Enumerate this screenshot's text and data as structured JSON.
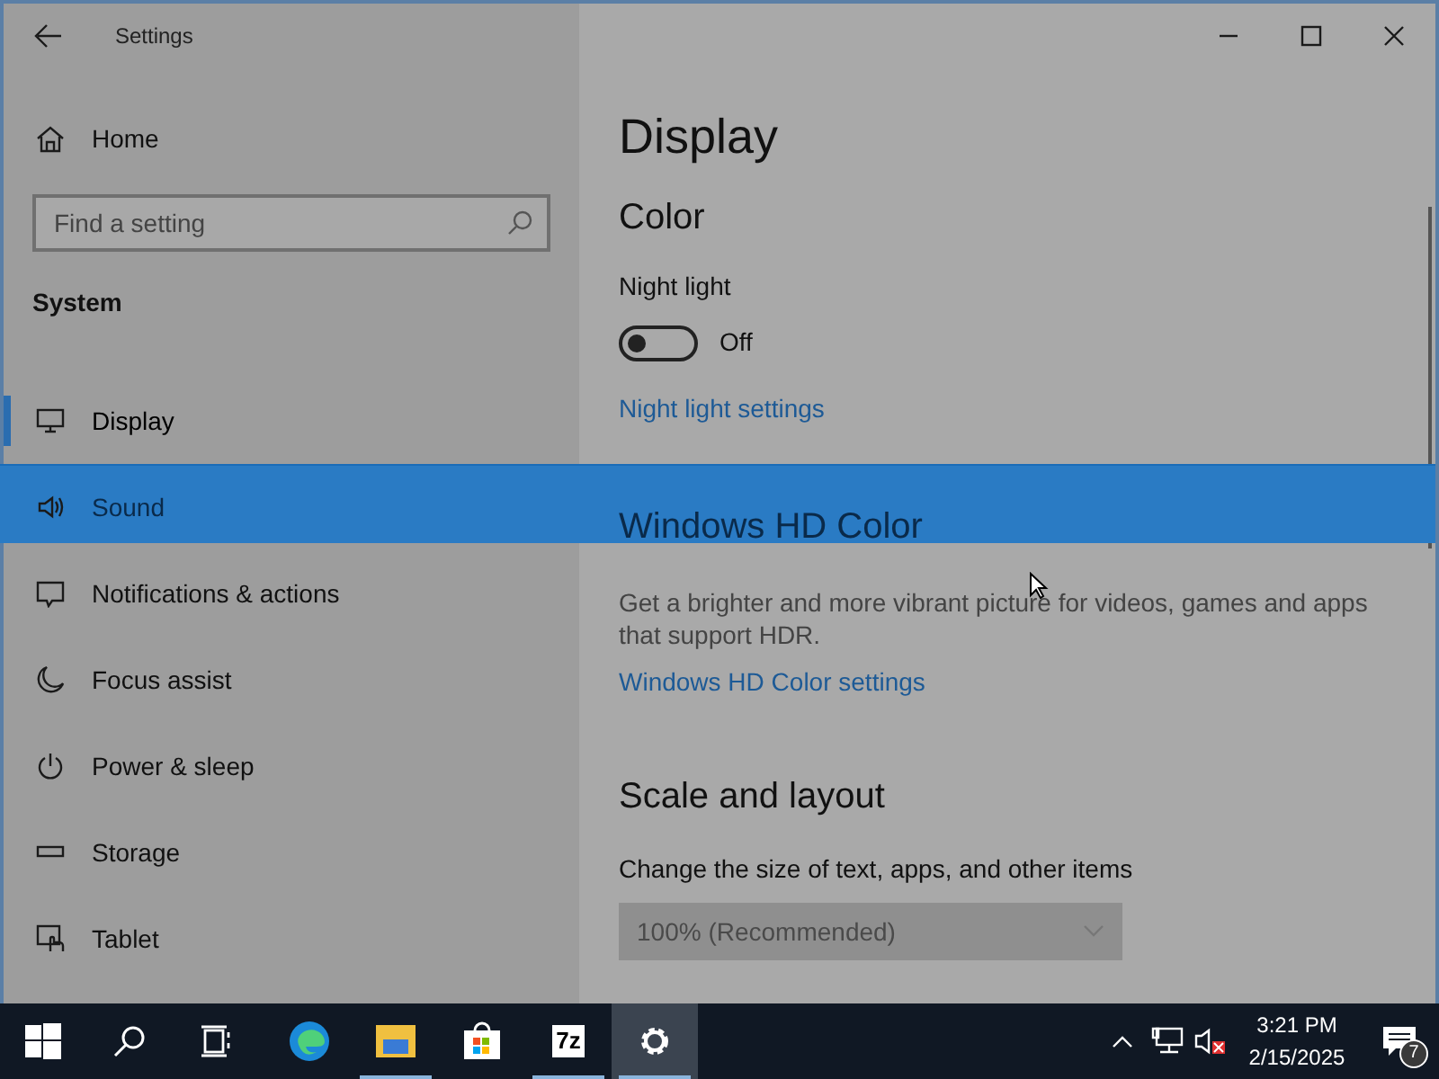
{
  "window": {
    "title": "Settings"
  },
  "sidebar": {
    "home": "Home",
    "search": {
      "placeholder": "Find a setting"
    },
    "section": "System",
    "items": [
      {
        "label": "Display",
        "selected": true
      },
      {
        "label": "Sound",
        "selected": false
      },
      {
        "label": "Notifications & actions",
        "selected": false
      },
      {
        "label": "Focus assist",
        "selected": false
      },
      {
        "label": "Power & sleep",
        "selected": false
      },
      {
        "label": "Storage",
        "selected": false
      },
      {
        "label": "Tablet",
        "selected": false
      }
    ]
  },
  "content": {
    "title": "Display",
    "color": {
      "heading": "Color",
      "night_light": {
        "label": "Night light",
        "on": false,
        "state_text": "Off"
      },
      "link": "Night light settings"
    },
    "hd_color": {
      "heading": "Windows HD Color",
      "description": "Get a brighter and more vibrant picture for videos, games and apps that support HDR.",
      "link": "Windows HD Color settings"
    },
    "scale": {
      "heading": "Scale and layout",
      "label": "Change the size of text, apps, and other items",
      "dropdown": {
        "value": "100% (Recommended)",
        "disabled": true
      }
    }
  },
  "taskbar": {
    "apps": [
      {
        "kind": "start",
        "running": false,
        "active": false
      },
      {
        "kind": "search",
        "running": false,
        "active": false
      },
      {
        "kind": "taskview",
        "running": false,
        "active": false
      },
      {
        "kind": "edge",
        "running": false,
        "active": false
      },
      {
        "kind": "explorer",
        "running": true,
        "active": false
      },
      {
        "kind": "store",
        "running": false,
        "active": false
      },
      {
        "kind": "archiver",
        "label": "7z",
        "running": true,
        "active": false
      },
      {
        "kind": "settings",
        "running": true,
        "active": true
      }
    ],
    "tray": {
      "time": "3:21 PM",
      "date": "2/15/2025",
      "notification_count": "7"
    }
  }
}
